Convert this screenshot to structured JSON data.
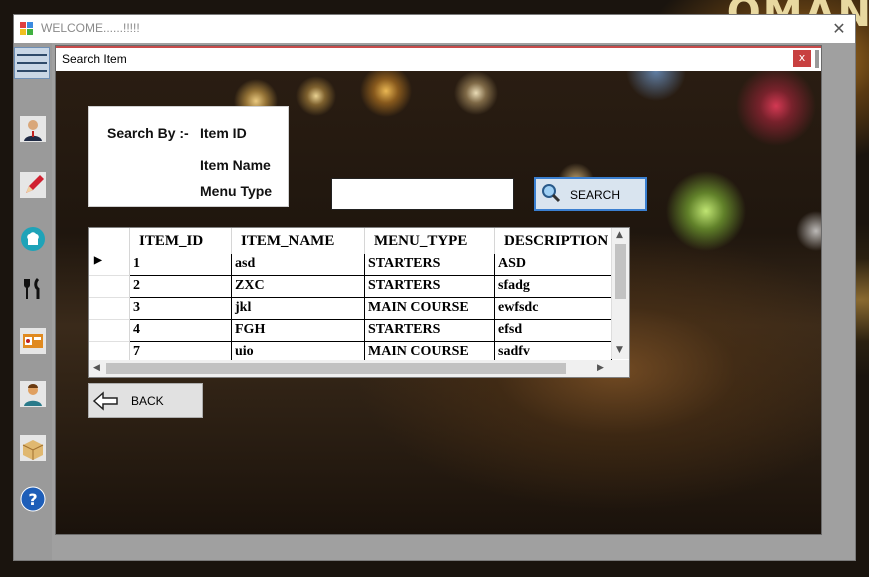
{
  "window": {
    "title": "WELCOME......!!!!!"
  },
  "desktop": {
    "bg_text": "OMAN"
  },
  "sidebar": {
    "items": [
      {
        "icon": "user-icon"
      },
      {
        "icon": "pen-icon"
      },
      {
        "icon": "chef-hat-icon"
      },
      {
        "icon": "fork-knife-icon"
      },
      {
        "icon": "menu-card-icon"
      },
      {
        "icon": "staff-icon"
      },
      {
        "icon": "box-icon"
      },
      {
        "icon": "help-icon"
      }
    ]
  },
  "dialog": {
    "title": "Search Item",
    "close_label": "x"
  },
  "search_by": {
    "label": "Search By :-",
    "options": [
      "Item ID",
      "Item Name",
      "Menu Type"
    ]
  },
  "search": {
    "value": "",
    "button_label": "SEARCH"
  },
  "table": {
    "columns": [
      "ITEM_ID",
      "ITEM_NAME",
      "MENU_TYPE",
      "DESCRIPTION"
    ],
    "rows": [
      [
        "1",
        "asd",
        "STARTERS",
        "ASD"
      ],
      [
        "2",
        "ZXC",
        "STARTERS",
        "sfadg"
      ],
      [
        "3",
        "jkl",
        "MAIN COURSE",
        "ewfsdc"
      ],
      [
        "4",
        "FGH",
        "STARTERS",
        "efsd"
      ],
      [
        "7",
        "uio",
        "MAIN COURSE",
        "sadfv"
      ]
    ]
  },
  "back": {
    "label": "BACK"
  },
  "colors": {
    "accent": "#3a7fd0",
    "dialog_border": "#c74b4b"
  }
}
